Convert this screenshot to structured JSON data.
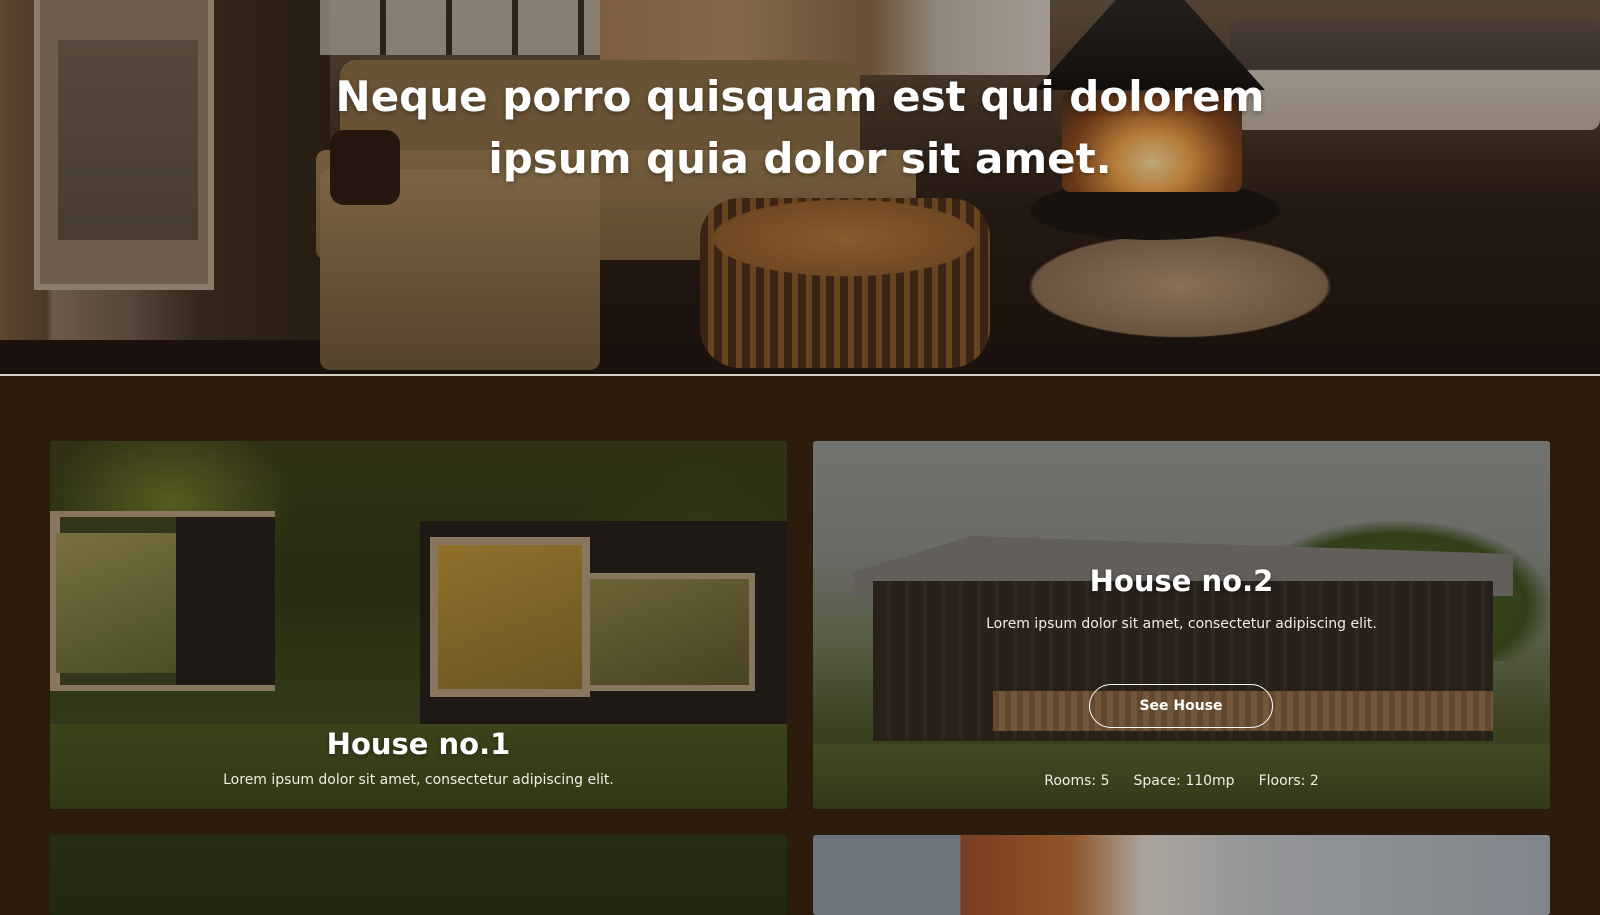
{
  "hero": {
    "title_line1": "Neque porro quisquam est qui dolorem",
    "title_line2": "ipsum quia dolor sit amet."
  },
  "houses": [
    {
      "title": "House no.1",
      "description": "Lorem ipsum dolor sit amet, consectetur adipiscing elit."
    },
    {
      "title": "House no.2",
      "description": "Lorem ipsum dolor sit amet, consectetur adipiscing elit.",
      "button_label": "See House",
      "rooms": "Rooms: 5",
      "space": "Space: 110mp",
      "floors": "Floors: 2"
    }
  ],
  "colors": {
    "background": "#2b1c0e",
    "text": "#ffffff",
    "divider": "#d8cfc3"
  }
}
